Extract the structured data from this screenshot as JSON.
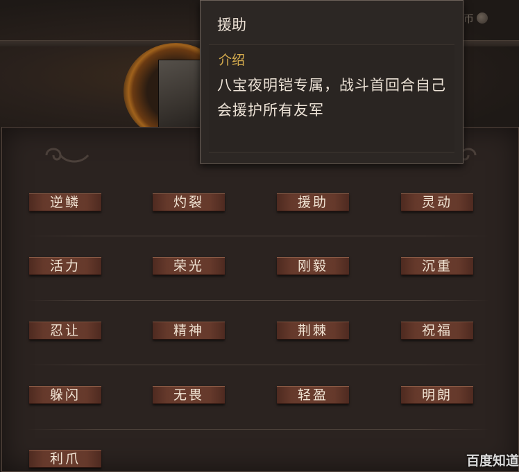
{
  "header": {
    "currency_text": "币"
  },
  "skills": [
    [
      "逆鳞",
      "灼裂",
      "援助",
      "灵动"
    ],
    [
      "活力",
      "荣光",
      "刚毅",
      "沉重"
    ],
    [
      "忍让",
      "精神",
      "荆棘",
      "祝福"
    ],
    [
      "躲闪",
      "无畏",
      "轻盈",
      "明朗"
    ],
    [
      "利爪"
    ]
  ],
  "tooltip": {
    "title": "援助",
    "subtitle": "介绍",
    "description": "八宝夜明铠专属，战斗首回合自己会援护所有友军"
  },
  "watermark": "百度知道"
}
